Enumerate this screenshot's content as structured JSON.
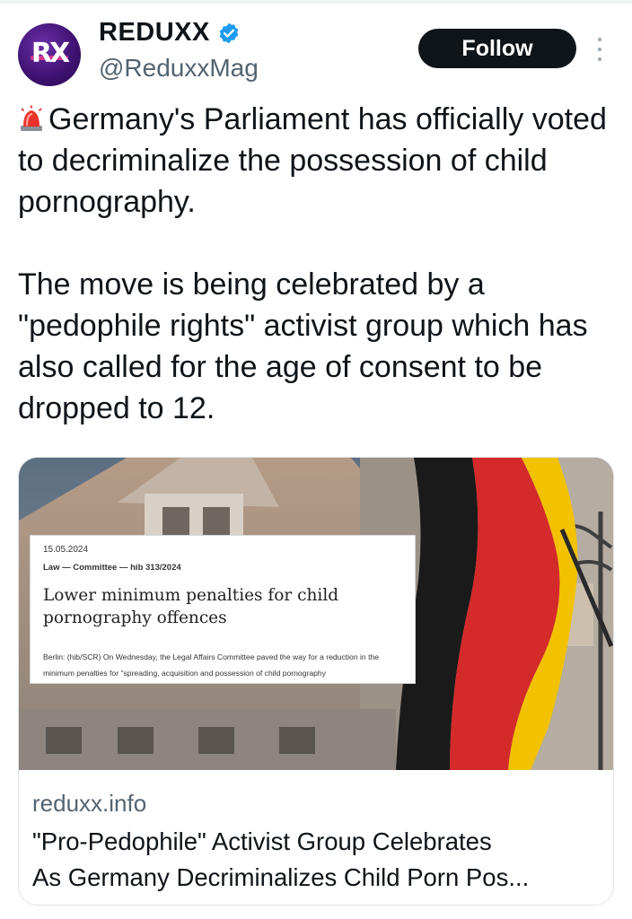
{
  "author": {
    "display_name": "REDUXX",
    "handle": "@ReduxxMag",
    "avatar_text": "RX",
    "verified": true
  },
  "actions": {
    "follow_label": "Follow"
  },
  "tweet": {
    "emoji": "siren-icon",
    "paragraph_1": "Germany's Parliament has officially voted to decriminalize the possession of child pornography.",
    "paragraph_2": "The move is being celebrated by a \"pedophile rights\" activist group which has also called for the age of consent to be dropped to 12."
  },
  "card": {
    "image": {
      "clipping": {
        "date": "15.05.2024",
        "meta": "Law — Committee — hib 313/2024",
        "title": "Lower minimum penalties for child pornography offences",
        "body": "Berlin: (hib/SCR) On Wednesday, the Legal Affairs Committee paved the way for a reduction in the minimum penalties for \"spreading, acquisition and possession of child pornography"
      }
    },
    "domain": "reduxx.info",
    "title_line_1": "\"Pro-Pedophile\" Activist Group Celebrates",
    "title_line_2": "As Germany Decriminalizes Child Porn Pos..."
  },
  "colors": {
    "text_primary": "#0f1419",
    "text_secondary": "#536471",
    "verified_blue": "#1d9bf0",
    "flag_black": "#1a1a1a",
    "flag_red": "#d42a2a",
    "flag_gold": "#f2c200"
  }
}
